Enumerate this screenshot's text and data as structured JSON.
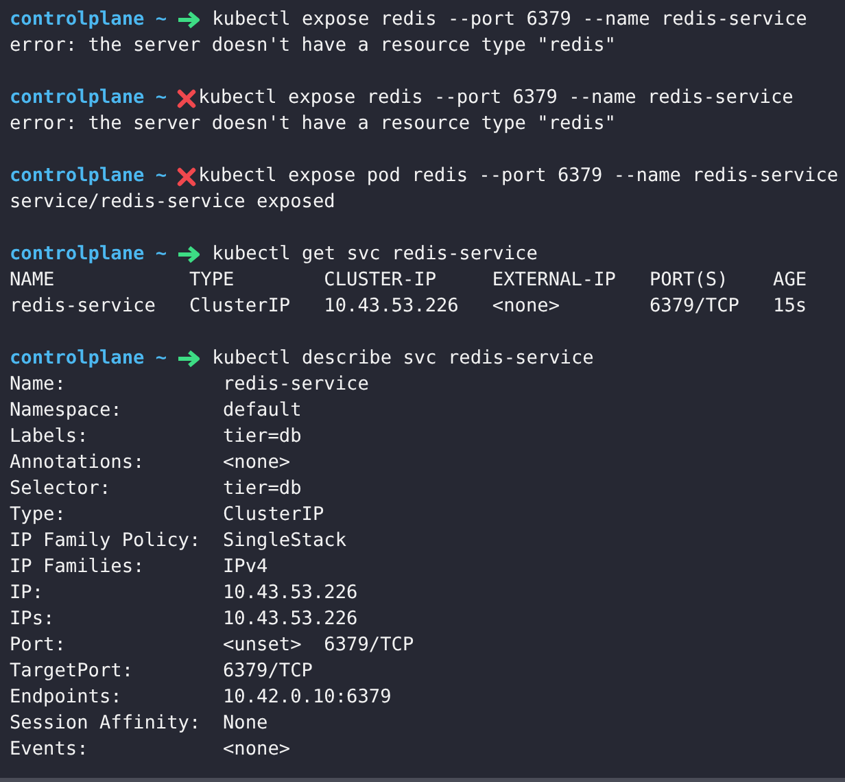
{
  "blocks": [
    {
      "prompt": {
        "host": "controlplane ~",
        "failed": false,
        "command": "kubectl expose redis --port 6379 --name redis-service"
      },
      "output": [
        "error: the server doesn't have a resource type \"redis\""
      ]
    },
    {
      "prompt": {
        "host": "controlplane ~",
        "failed": true,
        "command": "kubectl expose redis --port 6379 --name redis-service"
      },
      "output": [
        "error: the server doesn't have a resource type \"redis\""
      ]
    },
    {
      "prompt": {
        "host": "controlplane ~",
        "failed": true,
        "command": "kubectl expose pod redis --port 6379 --name redis-service"
      },
      "output": [
        "service/redis-service exposed"
      ]
    },
    {
      "prompt": {
        "host": "controlplane ~",
        "failed": false,
        "command": "kubectl get svc redis-service"
      },
      "output": [
        "NAME            TYPE        CLUSTER-IP     EXTERNAL-IP   PORT(S)    AGE",
        "redis-service   ClusterIP   10.43.53.226   <none>        6379/TCP   15s"
      ]
    },
    {
      "prompt": {
        "host": "controlplane ~",
        "failed": false,
        "command": "kubectl describe svc redis-service"
      },
      "output": [
        "Name:              redis-service",
        "Namespace:         default",
        "Labels:            tier=db",
        "Annotations:       <none>",
        "Selector:          tier=db",
        "Type:              ClusterIP",
        "IP Family Policy:  SingleStack",
        "IP Families:       IPv4",
        "IP:                10.43.53.226",
        "IPs:               10.43.53.226",
        "Port:              <unset>  6379/TCP",
        "TargetPort:        6379/TCP",
        "Endpoints:         10.42.0.10:6379",
        "Session Affinity:  None",
        "Events:            <none>"
      ]
    }
  ]
}
